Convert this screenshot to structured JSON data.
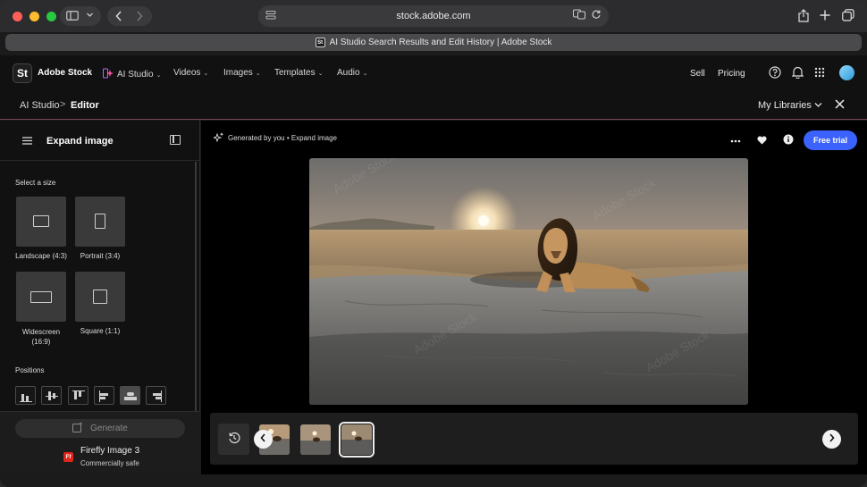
{
  "browser": {
    "url": "stock.adobe.com",
    "tab_title": "AI Studio Search Results and Edit History | Adobe Stock",
    "tab_favicon": "St"
  },
  "site_nav": {
    "logo": "St",
    "brand": "Adobe Stock",
    "items": [
      {
        "label": "AI Studio",
        "icon": "ai-studio-icon"
      },
      {
        "label": "Videos"
      },
      {
        "label": "Images"
      },
      {
        "label": "Templates"
      },
      {
        "label": "Audio"
      }
    ],
    "sell": "Sell",
    "pricing": "Pricing"
  },
  "breadcrumb": {
    "parent": "AI Studio",
    "separator": ">",
    "current": "Editor"
  },
  "my_libraries": "My Libraries",
  "left_panel": {
    "title": "Expand image",
    "select_size": "Select a size",
    "sizes": [
      {
        "label": "Landscape (4:3)"
      },
      {
        "label": "Portrait (3:4)"
      },
      {
        "label": "Widescreen (16:9)"
      },
      {
        "label": "Square (1:1)"
      }
    ],
    "positions_label": "Positions",
    "generate": "Generate",
    "model_badge": "Ff",
    "model_name": "Firefly Image 3",
    "model_sub": "Commercially safe"
  },
  "main": {
    "generated_by": "Generated by you • Expand image",
    "free_trial": "Free trial",
    "accent_color": "#3b63fb"
  }
}
